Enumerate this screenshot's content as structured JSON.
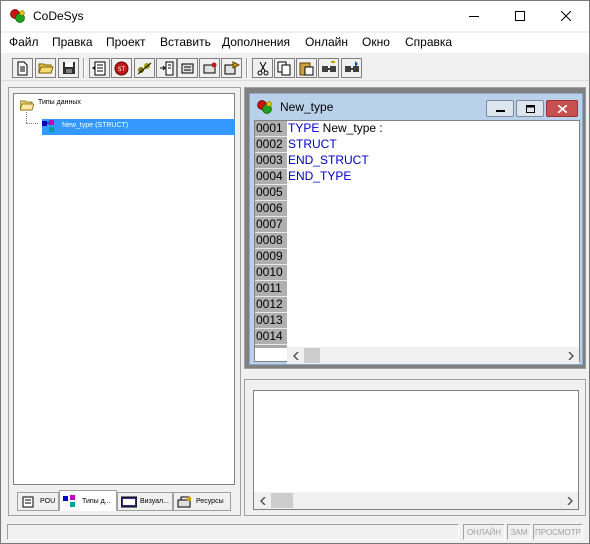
{
  "window": {
    "title": "CoDeSys"
  },
  "menu": [
    "Файл",
    "Правка",
    "Проект",
    "Вставить",
    "Дополнения",
    "Онлайн",
    "Окно",
    "Справка"
  ],
  "toolbar": {
    "buttons": [
      "new-icon",
      "open-icon",
      "save-icon",
      "declarations-icon",
      "stop-icon",
      "step-icon",
      "reset-icon",
      "breakpoint-icon",
      "write-icon",
      "force-icon",
      "cut-icon",
      "copy-icon",
      "paste-icon",
      "find-icon",
      "replace-icon"
    ]
  },
  "tree": {
    "root_label": "Типы данных",
    "items": [
      {
        "label": "New_type (STRUCT)",
        "selected": true
      }
    ]
  },
  "tabs": [
    {
      "label": "POU",
      "active": false
    },
    {
      "label": "Типы д...",
      "active": true
    },
    {
      "label": "Визуал...",
      "active": false
    },
    {
      "label": "Ресурсы",
      "active": false
    }
  ],
  "editor": {
    "title": "New_type",
    "line_numbers": [
      "0001",
      "0002",
      "0003",
      "0004",
      "0005",
      "0006",
      "0007",
      "0008",
      "0009",
      "0010",
      "0011",
      "0012",
      "0013",
      "0014"
    ],
    "code_lines": [
      {
        "keyword": "TYPE",
        "rest": " New_type :"
      },
      {
        "keyword": "STRUCT",
        "rest": ""
      },
      {
        "keyword": "END_STRUCT",
        "rest": ""
      },
      {
        "keyword": "END_TYPE",
        "rest": ""
      }
    ]
  },
  "status": {
    "online": "ОНЛАЙН",
    "zam": "ЗАМ",
    "view": "ПРОСМОТР"
  },
  "colors": {
    "selection": "#3399ff",
    "keyword": "#0000c0",
    "mdi_title": "#b9d1ea",
    "mdi_close": "#c75050"
  }
}
